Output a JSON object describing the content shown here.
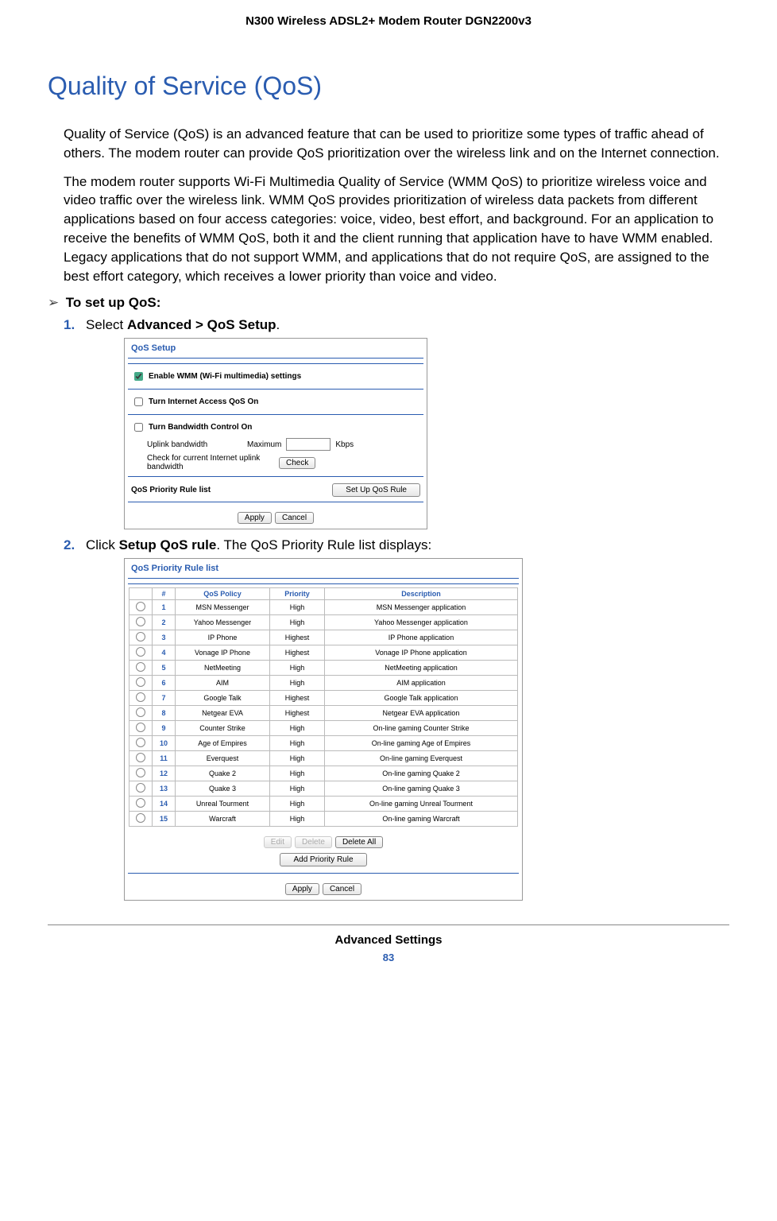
{
  "header": {
    "running_head": "N300 Wireless ADSL2+ Modem Router DGN2200v3"
  },
  "title": "Quality of Service (QoS)",
  "body": {
    "p1": "Quality of Service (QoS) is an advanced feature that can be used to prioritize some types of traffic ahead of others. The modem router can provide QoS prioritization over the wireless link and on the Internet connection.",
    "p2": "The modem router supports Wi-Fi Multimedia Quality of Service (WMM QoS) to prioritize wireless voice and video traffic over the wireless link. WMM QoS provides prioritization of wireless data packets from different applications based on four access categories: voice, video, best effort, and background. For an application to receive the benefits of WMM QoS, both it and the client running that application have to have WMM enabled. Legacy applications that do not support WMM, and applications that do not require QoS, are assigned to the best effort category, which receives a lower priority than voice and video.",
    "task_heading": "To set up QoS:",
    "step1_a": "Select ",
    "step1_b": "Advanced > QoS Setup",
    "step1_c": ".",
    "step2_a": "Click ",
    "step2_b": "Setup QoS rule",
    "step2_c": ". The QoS Priority Rule list displays:"
  },
  "qos_setup": {
    "title": "QoS Setup",
    "wmm_label": "Enable WMM (Wi-Fi multimedia) settings",
    "internet_label": "Turn Internet Access QoS On",
    "bandwidth_label": "Turn Bandwidth Control On",
    "uplink_label": "Uplink bandwidth",
    "maximum": "Maximum",
    "kbps": "Kbps",
    "check_label": "Check for current Internet uplink bandwidth",
    "check_btn": "Check",
    "priority_label": "QoS Priority Rule list",
    "setup_btn": "Set Up QoS Rule",
    "apply": "Apply",
    "cancel": "Cancel"
  },
  "rule_list": {
    "title": "QoS Priority Rule list",
    "headers": {
      "num": "#",
      "policy": "QoS Policy",
      "priority": "Priority",
      "desc": "Description"
    },
    "rows": [
      {
        "n": "1",
        "policy": "MSN Messenger",
        "priority": "High",
        "desc": "MSN Messenger application"
      },
      {
        "n": "2",
        "policy": "Yahoo Messenger",
        "priority": "High",
        "desc": "Yahoo Messenger application"
      },
      {
        "n": "3",
        "policy": "IP Phone",
        "priority": "Highest",
        "desc": "IP Phone application"
      },
      {
        "n": "4",
        "policy": "Vonage IP Phone",
        "priority": "Highest",
        "desc": "Vonage IP Phone application"
      },
      {
        "n": "5",
        "policy": "NetMeeting",
        "priority": "High",
        "desc": "NetMeeting application"
      },
      {
        "n": "6",
        "policy": "AIM",
        "priority": "High",
        "desc": "AIM application"
      },
      {
        "n": "7",
        "policy": "Google Talk",
        "priority": "Highest",
        "desc": "Google Talk application"
      },
      {
        "n": "8",
        "policy": "Netgear EVA",
        "priority": "Highest",
        "desc": "Netgear EVA application"
      },
      {
        "n": "9",
        "policy": "Counter Strike",
        "priority": "High",
        "desc": "On-line gaming Counter Strike"
      },
      {
        "n": "10",
        "policy": "Age of Empires",
        "priority": "High",
        "desc": "On-line gaming Age of Empires"
      },
      {
        "n": "11",
        "policy": "Everquest",
        "priority": "High",
        "desc": "On-line gaming Everquest"
      },
      {
        "n": "12",
        "policy": "Quake 2",
        "priority": "High",
        "desc": "On-line gaming Quake 2"
      },
      {
        "n": "13",
        "policy": "Quake 3",
        "priority": "High",
        "desc": "On-line gaming Quake 3"
      },
      {
        "n": "14",
        "policy": "Unreal Tourment",
        "priority": "High",
        "desc": "On-line gaming Unreal Tourment"
      },
      {
        "n": "15",
        "policy": "Warcraft",
        "priority": "High",
        "desc": "On-line gaming Warcraft"
      }
    ],
    "edit": "Edit",
    "delete": "Delete",
    "delete_all": "Delete All",
    "add_rule": "Add Priority Rule",
    "apply": "Apply",
    "cancel": "Cancel"
  },
  "footer": {
    "chapter": "Advanced Settings",
    "page": "83"
  }
}
